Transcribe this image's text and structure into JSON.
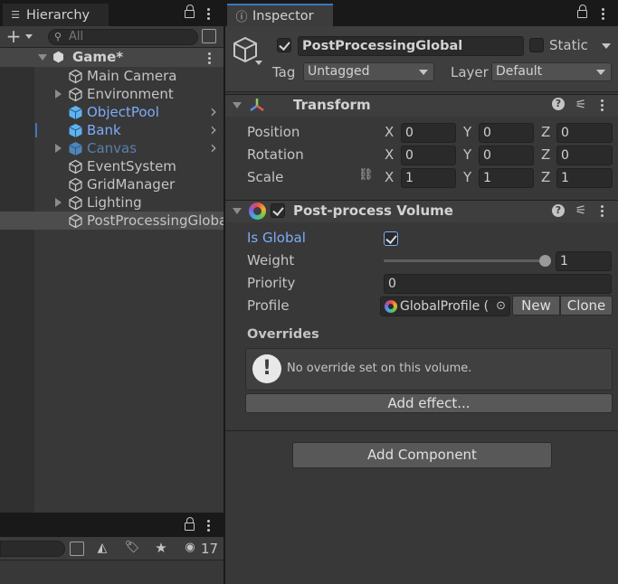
{
  "hierarchy": {
    "tab_label": "Hierarchy",
    "search_placeholder": "All",
    "scene_name": "Game*",
    "items": [
      {
        "label": "Main Camera",
        "kind": "plain"
      },
      {
        "label": "Environment",
        "kind": "plain",
        "expandable": true
      },
      {
        "label": "ObjectPool",
        "kind": "prefab"
      },
      {
        "label": "Bank",
        "kind": "prefab"
      },
      {
        "label": "Canvas",
        "kind": "prefab-inactive",
        "expandable": true
      },
      {
        "label": "EventSystem",
        "kind": "plain"
      },
      {
        "label": "GridManager",
        "kind": "plain"
      },
      {
        "label": "Lighting",
        "kind": "plain",
        "expandable": true
      },
      {
        "label": "PostProcessingGlobal",
        "kind": "plain",
        "selected": true
      }
    ]
  },
  "project_toolbar": {
    "hidden_count": "17"
  },
  "inspector": {
    "tab_label": "Inspector",
    "object_name": "PostProcessingGlobal",
    "active_checked": true,
    "static_label": "Static",
    "static_checked": false,
    "tag_label": "Tag",
    "tag_value": "Untagged",
    "layer_label": "Layer",
    "layer_value": "Default",
    "transform": {
      "title": "Transform",
      "position_label": "Position",
      "rotation_label": "Rotation",
      "scale_label": "Scale",
      "x_label": "X",
      "y_label": "Y",
      "z_label": "Z",
      "position": {
        "x": "0",
        "y": "0",
        "z": "0"
      },
      "rotation": {
        "x": "0",
        "y": "0",
        "z": "0"
      },
      "scale": {
        "x": "1",
        "y": "1",
        "z": "1"
      }
    },
    "volume": {
      "title": "Post-process Volume",
      "enabled": true,
      "is_global_label": "Is Global",
      "is_global": true,
      "weight_label": "Weight",
      "weight_value": "1",
      "weight_fraction": 1,
      "priority_label": "Priority",
      "priority_value": "0",
      "profile_label": "Profile",
      "profile_value": "GlobalProfile (",
      "new_label": "New",
      "clone_label": "Clone",
      "overrides_label": "Overrides",
      "no_override_text": "No override set on this volume.",
      "add_effect_label": "Add effect..."
    },
    "add_component_label": "Add Component"
  },
  "colors": {
    "accent_tab": "#3a79bb",
    "prefab_text": "#7cacf8",
    "selection_bg": "#4d4d4d"
  }
}
